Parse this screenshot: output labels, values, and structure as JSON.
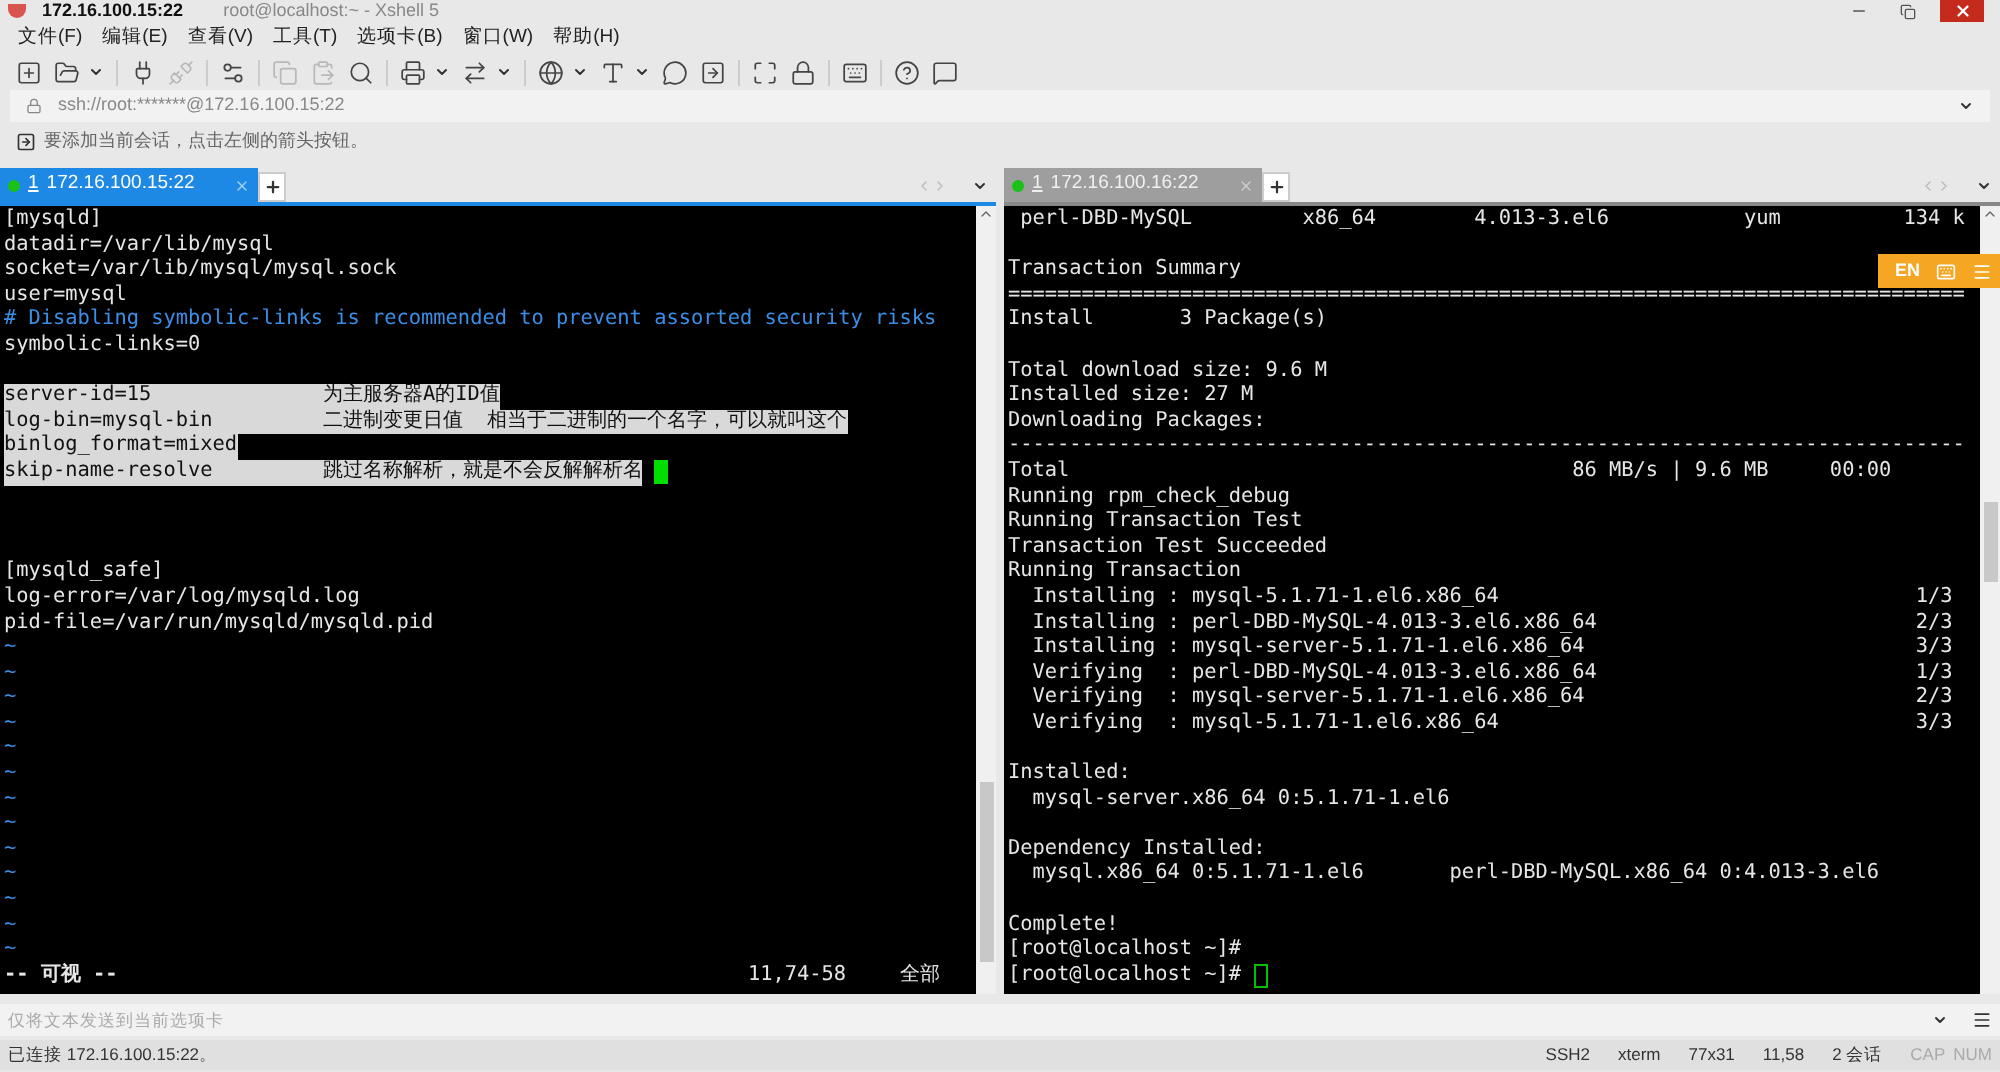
{
  "window": {
    "title": "172.16.100.15:22",
    "subtitle": "root@localhost:~ - Xshell 5"
  },
  "menu": [
    "文件(F)",
    "编辑(E)",
    "查看(V)",
    "工具(T)",
    "选项卡(B)",
    "窗口(W)",
    "帮助(H)"
  ],
  "address": "ssh://root:*******@172.16.100.15:22",
  "hint": "要添加当前会话，点击左侧的箭头按钮。",
  "panes": [
    {
      "tab": {
        "number": "1",
        "label": "172.16.100.15:22",
        "selected": true
      },
      "lines": [
        {
          "kind": "text",
          "text": "[mysqld]"
        },
        {
          "kind": "text",
          "text": "datadir=/var/lib/mysql"
        },
        {
          "kind": "text",
          "text": "socket=/var/lib/mysql/mysql.sock"
        },
        {
          "kind": "text",
          "text": "user=mysql"
        },
        {
          "kind": "comment",
          "text": "# Disabling symbolic-links is recommended to prevent assorted security risks"
        },
        {
          "kind": "text",
          "text": "symbolic-links=0"
        },
        {
          "kind": "blank"
        },
        {
          "kind": "highlight",
          "text": "server-id=15              为主服务器A的ID值"
        },
        {
          "kind": "highlight",
          "text": "log-bin=mysql-bin         二进制变更日值  相当于二进制的一个名字，可以就叫这个"
        },
        {
          "kind": "highlight",
          "text": "binlog_format=mixed"
        },
        {
          "kind": "highlight",
          "text": "skip-name-resolve         跳过名称解析，就是不会反解解析名",
          "cursor": true
        },
        {
          "kind": "blank"
        },
        {
          "kind": "blank"
        },
        {
          "kind": "blank"
        },
        {
          "kind": "text",
          "text": "[mysqld_safe]"
        },
        {
          "kind": "text",
          "text": "log-error=/var/log/mysqld.log"
        },
        {
          "kind": "text",
          "text": "pid-file=/var/run/mysqld/mysqld.pid"
        },
        {
          "kind": "tilde",
          "text": "~"
        },
        {
          "kind": "tilde",
          "text": "~"
        },
        {
          "kind": "tilde",
          "text": "~"
        },
        {
          "kind": "tilde",
          "text": "~"
        },
        {
          "kind": "tilde",
          "text": "~"
        },
        {
          "kind": "tilde",
          "text": "~"
        },
        {
          "kind": "tilde",
          "text": "~"
        },
        {
          "kind": "tilde",
          "text": "~"
        },
        {
          "kind": "tilde",
          "text": "~"
        },
        {
          "kind": "tilde",
          "text": "~"
        },
        {
          "kind": "tilde",
          "text": "~"
        },
        {
          "kind": "tilde",
          "text": "~"
        },
        {
          "kind": "tilde",
          "text": "~"
        }
      ],
      "status": {
        "mode": "-- 可视 --",
        "position": "11,74-58",
        "scope": "全部"
      }
    },
    {
      "tab": {
        "number": "1",
        "label": "172.16.100.16:22",
        "selected": false
      },
      "ime": "EN",
      "lines": [
        {
          "kind": "text",
          "text": " perl-DBD-MySQL         x86_64        4.013-3.el6           yum          134 k"
        },
        {
          "kind": "blank"
        },
        {
          "kind": "text",
          "text": "Transaction Summary"
        },
        {
          "kind": "text",
          "text": "=============================================================================="
        },
        {
          "kind": "text",
          "text": "Install       3 Package(s)"
        },
        {
          "kind": "blank"
        },
        {
          "kind": "text",
          "text": "Total download size: 9.6 M"
        },
        {
          "kind": "text",
          "text": "Installed size: 27 M"
        },
        {
          "kind": "text",
          "text": "Downloading Packages:"
        },
        {
          "kind": "text",
          "text": "------------------------------------------------------------------------------"
        },
        {
          "kind": "text",
          "text": "Total                                         86 MB/s | 9.6 MB     00:00"
        },
        {
          "kind": "text",
          "text": "Running rpm_check_debug"
        },
        {
          "kind": "text",
          "text": "Running Transaction Test"
        },
        {
          "kind": "text",
          "text": "Transaction Test Succeeded"
        },
        {
          "kind": "text",
          "text": "Running Transaction"
        },
        {
          "kind": "text",
          "text": "  Installing : mysql-5.1.71-1.el6.x86_64                                  1/3"
        },
        {
          "kind": "text",
          "text": "  Installing : perl-DBD-MySQL-4.013-3.el6.x86_64                          2/3"
        },
        {
          "kind": "text",
          "text": "  Installing : mysql-server-5.1.71-1.el6.x86_64                           3/3"
        },
        {
          "kind": "text",
          "text": "  Verifying  : perl-DBD-MySQL-4.013-3.el6.x86_64                          1/3"
        },
        {
          "kind": "text",
          "text": "  Verifying  : mysql-server-5.1.71-1.el6.x86_64                           2/3"
        },
        {
          "kind": "text",
          "text": "  Verifying  : mysql-5.1.71-1.el6.x86_64                                  3/3"
        },
        {
          "kind": "blank"
        },
        {
          "kind": "text",
          "text": "Installed:"
        },
        {
          "kind": "text",
          "text": "  mysql-server.x86_64 0:5.1.71-1.el6"
        },
        {
          "kind": "blank"
        },
        {
          "kind": "text",
          "text": "Dependency Installed:"
        },
        {
          "kind": "text",
          "text": "  mysql.x86_64 0:5.1.71-1.el6       perl-DBD-MySQL.x86_64 0:4.013-3.el6"
        },
        {
          "kind": "blank"
        },
        {
          "kind": "text",
          "text": "Complete!"
        },
        {
          "kind": "text",
          "text": "[root@localhost ~]#"
        },
        {
          "kind": "text",
          "text": "[root@localhost ~]#",
          "cursor": true
        }
      ]
    }
  ],
  "input_bar": {
    "placeholder": "仅将文本发送到当前选项卡"
  },
  "status_bar": {
    "message": "已连接 172.16.100.15:22。",
    "items": [
      "SSH2",
      "xterm",
      "77x31",
      "11,58",
      "2 会话"
    ],
    "keys": [
      "CAP",
      "NUM"
    ]
  }
}
